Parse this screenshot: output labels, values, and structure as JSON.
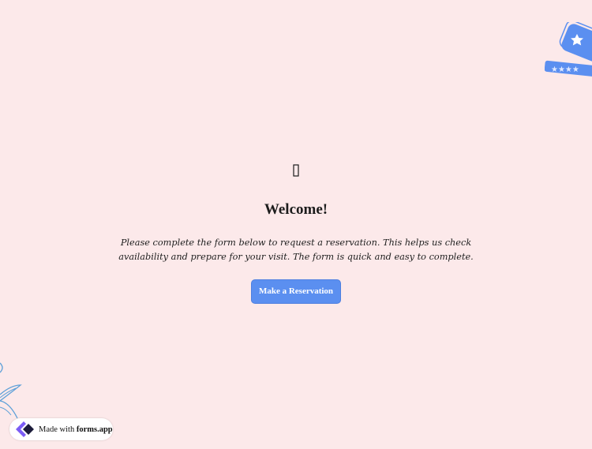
{
  "welcome": {
    "icon": "missing-glyph-icon",
    "title": "Welcome!",
    "description": "Please complete the form below to request a reservation. This helps us check availability and prepare for your visit. The form is quick and easy to complete.",
    "button_label": "Make a Reservation"
  },
  "badge": {
    "prefix": "Made with",
    "brand": "forms.app",
    "icon": "forms-app-logo-icon"
  },
  "decorations": {
    "top_right": "star-badge-icon",
    "bottom_left": "leaf-icon"
  },
  "colors": {
    "background": "#fce9ea",
    "accent": "#5b8ff0",
    "text": "#1c1c1c"
  }
}
